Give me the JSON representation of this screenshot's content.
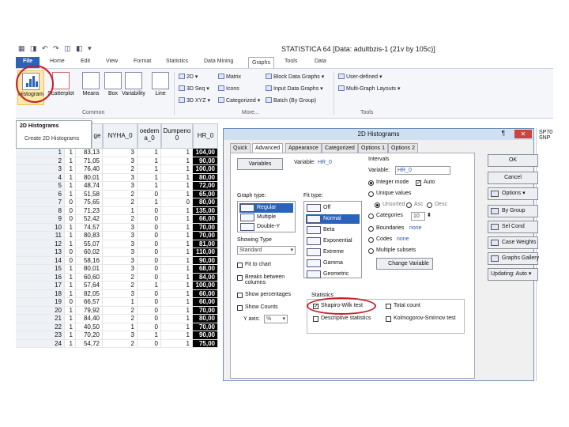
{
  "window": {
    "title": "STATISTICA 64    [Data: adultbzis-1 (21v by 105c)]"
  },
  "menu_tabs": [
    "File",
    "Home",
    "Edit",
    "View",
    "Format",
    "Statistics",
    "Data Mining",
    "Graphs",
    "Tools",
    "Data"
  ],
  "ribbon": {
    "common_label": "Common",
    "more_label": "More...",
    "tools_label": "Tools",
    "common_buttons": [
      "Histogram",
      "Scatterplot",
      "Means",
      "Box",
      "Variability",
      "Line"
    ],
    "more_col1": [
      "2D ▾",
      "3D Seq ▾",
      "3D XYZ ▾"
    ],
    "more_col2": [
      "Matrix",
      "Icons",
      "Categorized ▾"
    ],
    "more_col3": [
      "Block Data Graphs ▾",
      "Input Data Graphs ▾",
      "Batch (By Group)"
    ],
    "tools_items": [
      "User-defined ▾",
      "Multi-Graph Layouts ▾"
    ]
  },
  "tooltip": {
    "title": "2D Histograms",
    "desc": "Create 2D Histograms"
  },
  "sheet": {
    "headers": [
      "NYHA_0",
      "oedem a_0",
      "Dumpeno 0",
      "HR_0"
    ],
    "partial_header": "ge",
    "right_header": "SP70 SNP",
    "rows": [
      {
        "n": "1",
        "a": "1",
        "b": "83,13",
        "c": "3",
        "d": "1",
        "e": "1",
        "hr": "104,00"
      },
      {
        "n": "2",
        "a": "1",
        "b": "71,05",
        "c": "3",
        "d": "1",
        "e": "1",
        "hr": "90,00"
      },
      {
        "n": "3",
        "a": "1",
        "b": "76,40",
        "c": "2",
        "d": "1",
        "e": "1",
        "hr": "100,00"
      },
      {
        "n": "4",
        "a": "1",
        "b": "80,01",
        "c": "3",
        "d": "1",
        "e": "1",
        "hr": "80,00"
      },
      {
        "n": "5",
        "a": "1",
        "b": "48,74",
        "c": "3",
        "d": "1",
        "e": "1",
        "hr": "72,00"
      },
      {
        "n": "6",
        "a": "1",
        "b": "51,58",
        "c": "2",
        "d": "0",
        "e": "1",
        "hr": "65,00"
      },
      {
        "n": "7",
        "a": "0",
        "b": "75,65",
        "c": "2",
        "d": "1",
        "e": "0",
        "hr": "80,00"
      },
      {
        "n": "8",
        "a": "0",
        "b": "71,23",
        "c": "1",
        "d": "0",
        "e": "1",
        "hr": "135,00"
      },
      {
        "n": "9",
        "a": "0",
        "b": "52,42",
        "c": "2",
        "d": "0",
        "e": "1",
        "hr": "66,00"
      },
      {
        "n": "10",
        "a": "1",
        "b": "74,57",
        "c": "3",
        "d": "0",
        "e": "1",
        "hr": "70,00"
      },
      {
        "n": "11",
        "a": "1",
        "b": "80,83",
        "c": "3",
        "d": "0",
        "e": "1",
        "hr": "70,00"
      },
      {
        "n": "12",
        "a": "1",
        "b": "55,07",
        "c": "3",
        "d": "0",
        "e": "1",
        "hr": "81,00"
      },
      {
        "n": "13",
        "a": "0",
        "b": "60,02",
        "c": "3",
        "d": "0",
        "e": "1",
        "hr": "110,00"
      },
      {
        "n": "14",
        "a": "0",
        "b": "58,16",
        "c": "3",
        "d": "0",
        "e": "1",
        "hr": "90,00"
      },
      {
        "n": "15",
        "a": "1",
        "b": "80,01",
        "c": "3",
        "d": "0",
        "e": "1",
        "hr": "68,00"
      },
      {
        "n": "16",
        "a": "1",
        "b": "60,60",
        "c": "2",
        "d": "0",
        "e": "1",
        "hr": "84,00"
      },
      {
        "n": "17",
        "a": "1",
        "b": "57,64",
        "c": "2",
        "d": "1",
        "e": "1",
        "hr": "100,00"
      },
      {
        "n": "18",
        "a": "1",
        "b": "82,05",
        "c": "3",
        "d": "0",
        "e": "1",
        "hr": "60,00"
      },
      {
        "n": "19",
        "a": "0",
        "b": "66,57",
        "c": "1",
        "d": "0",
        "e": "1",
        "hr": "60,00"
      },
      {
        "n": "20",
        "a": "1",
        "b": "79,92",
        "c": "2",
        "d": "0",
        "e": "1",
        "hr": "70,00"
      },
      {
        "n": "21",
        "a": "1",
        "b": "84,40",
        "c": "2",
        "d": "0",
        "e": "1",
        "hr": "80,00"
      },
      {
        "n": "22",
        "a": "1",
        "b": "40,50",
        "c": "1",
        "d": "0",
        "e": "1",
        "hr": "70,00"
      },
      {
        "n": "23",
        "a": "1",
        "b": "70,20",
        "c": "3",
        "d": "1",
        "e": "1",
        "hr": "90,00"
      },
      {
        "n": "24",
        "a": "1",
        "b": "54,72",
        "c": "2",
        "d": "0",
        "e": "1",
        "hr": "75,00"
      }
    ]
  },
  "dialog": {
    "title": "2D Histograms",
    "pin": "¶",
    "close": "✕",
    "tabs": [
      "Quick",
      "Advanced",
      "Appearance",
      "Categorized",
      "Options 1",
      "Options 2"
    ],
    "variables_button": "Variables",
    "variable_label": "Variable:",
    "variable_value": "HR_0",
    "graph_type_label": "Graph type:",
    "graph_types": [
      "Regular",
      "Multiple",
      "Double-Y"
    ],
    "showing_type_label": "Showing Type",
    "showing_type_value": "Standard",
    "fit_type_label": "Fit type:",
    "fit_types": [
      "Off",
      "Normal",
      "Beta",
      "Exponential",
      "Extreme",
      "Gamma",
      "Geometric"
    ],
    "intervals_label": "Intervals",
    "intervals_variable_label": "Variable:",
    "intervals_variable_value": "HR_0",
    "integer_mode": "Integer mode",
    "auto": "Auto",
    "unique_values": "Unique values",
    "unsorted": "Unsorted",
    "asc": "Asc",
    "desc": "Desc",
    "categories": "Categories",
    "categories_value": "10",
    "boundaries": "Boundaries",
    "boundaries_value": "none",
    "codes": "Codes",
    "codes_value": "none",
    "multiple_subsets": "Multiple subsets",
    "change_variable": "Change Variable",
    "breaks_columns": "Breaks between columns",
    "fit_to_chart": "Fit to chart",
    "show_percentages": "Show percentages",
    "show_counts": "Show Counts",
    "y_axis_label": "Y axis:",
    "y_axis_value": "%",
    "statistics_label": "Statistics",
    "shapiro_wilk": "Shapiro-Wilk test",
    "total_count": "Total count",
    "descriptive_stats": "Descriptive statistics",
    "kolmogorov": "Kolmogorov-Smirnov test",
    "side_buttons": [
      "OK",
      "Cancel",
      "Options ▾",
      "By Group",
      "Sel Cond",
      "Case Weights",
      "Graphs Gallery",
      "Updating: Auto ▾"
    ]
  }
}
